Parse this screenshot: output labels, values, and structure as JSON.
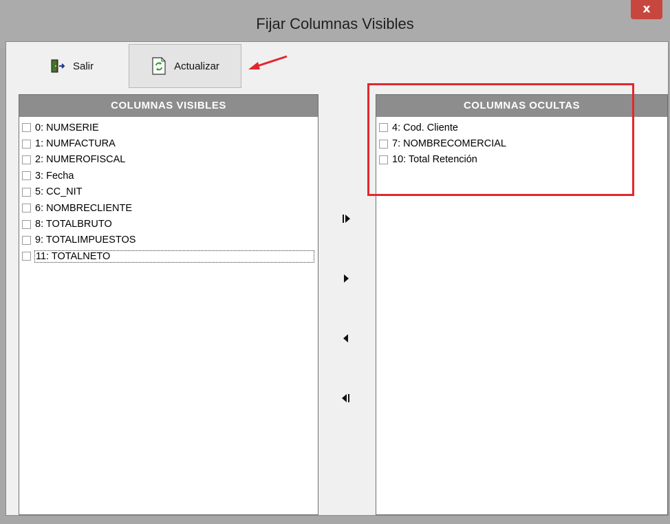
{
  "window": {
    "title": "Fijar Columnas Visibles",
    "close_label": "x"
  },
  "toolbar": {
    "salir_label": "Salir",
    "actualizar_label": "Actualizar"
  },
  "visible_panel": {
    "header": "COLUMNAS VISIBLES",
    "items": [
      "0: NUMSERIE",
      "1: NUMFACTURA",
      "2: NUMEROFISCAL",
      "3: Fecha",
      "5: CC_NIT",
      "6: NOMBRECLIENTE",
      "8: TOTALBRUTO",
      "9: TOTALIMPUESTOS",
      "11: TOTALNETO"
    ]
  },
  "hidden_panel": {
    "header": "COLUMNAS OCULTAS",
    "items": [
      "4: Cod. Cliente",
      "7: NOMBRECOMERCIAL",
      "10: Total Retención"
    ]
  },
  "colors": {
    "annotation_red": "#e3262d",
    "header_gray": "#8d8d8d",
    "close_red": "#c7473f"
  }
}
